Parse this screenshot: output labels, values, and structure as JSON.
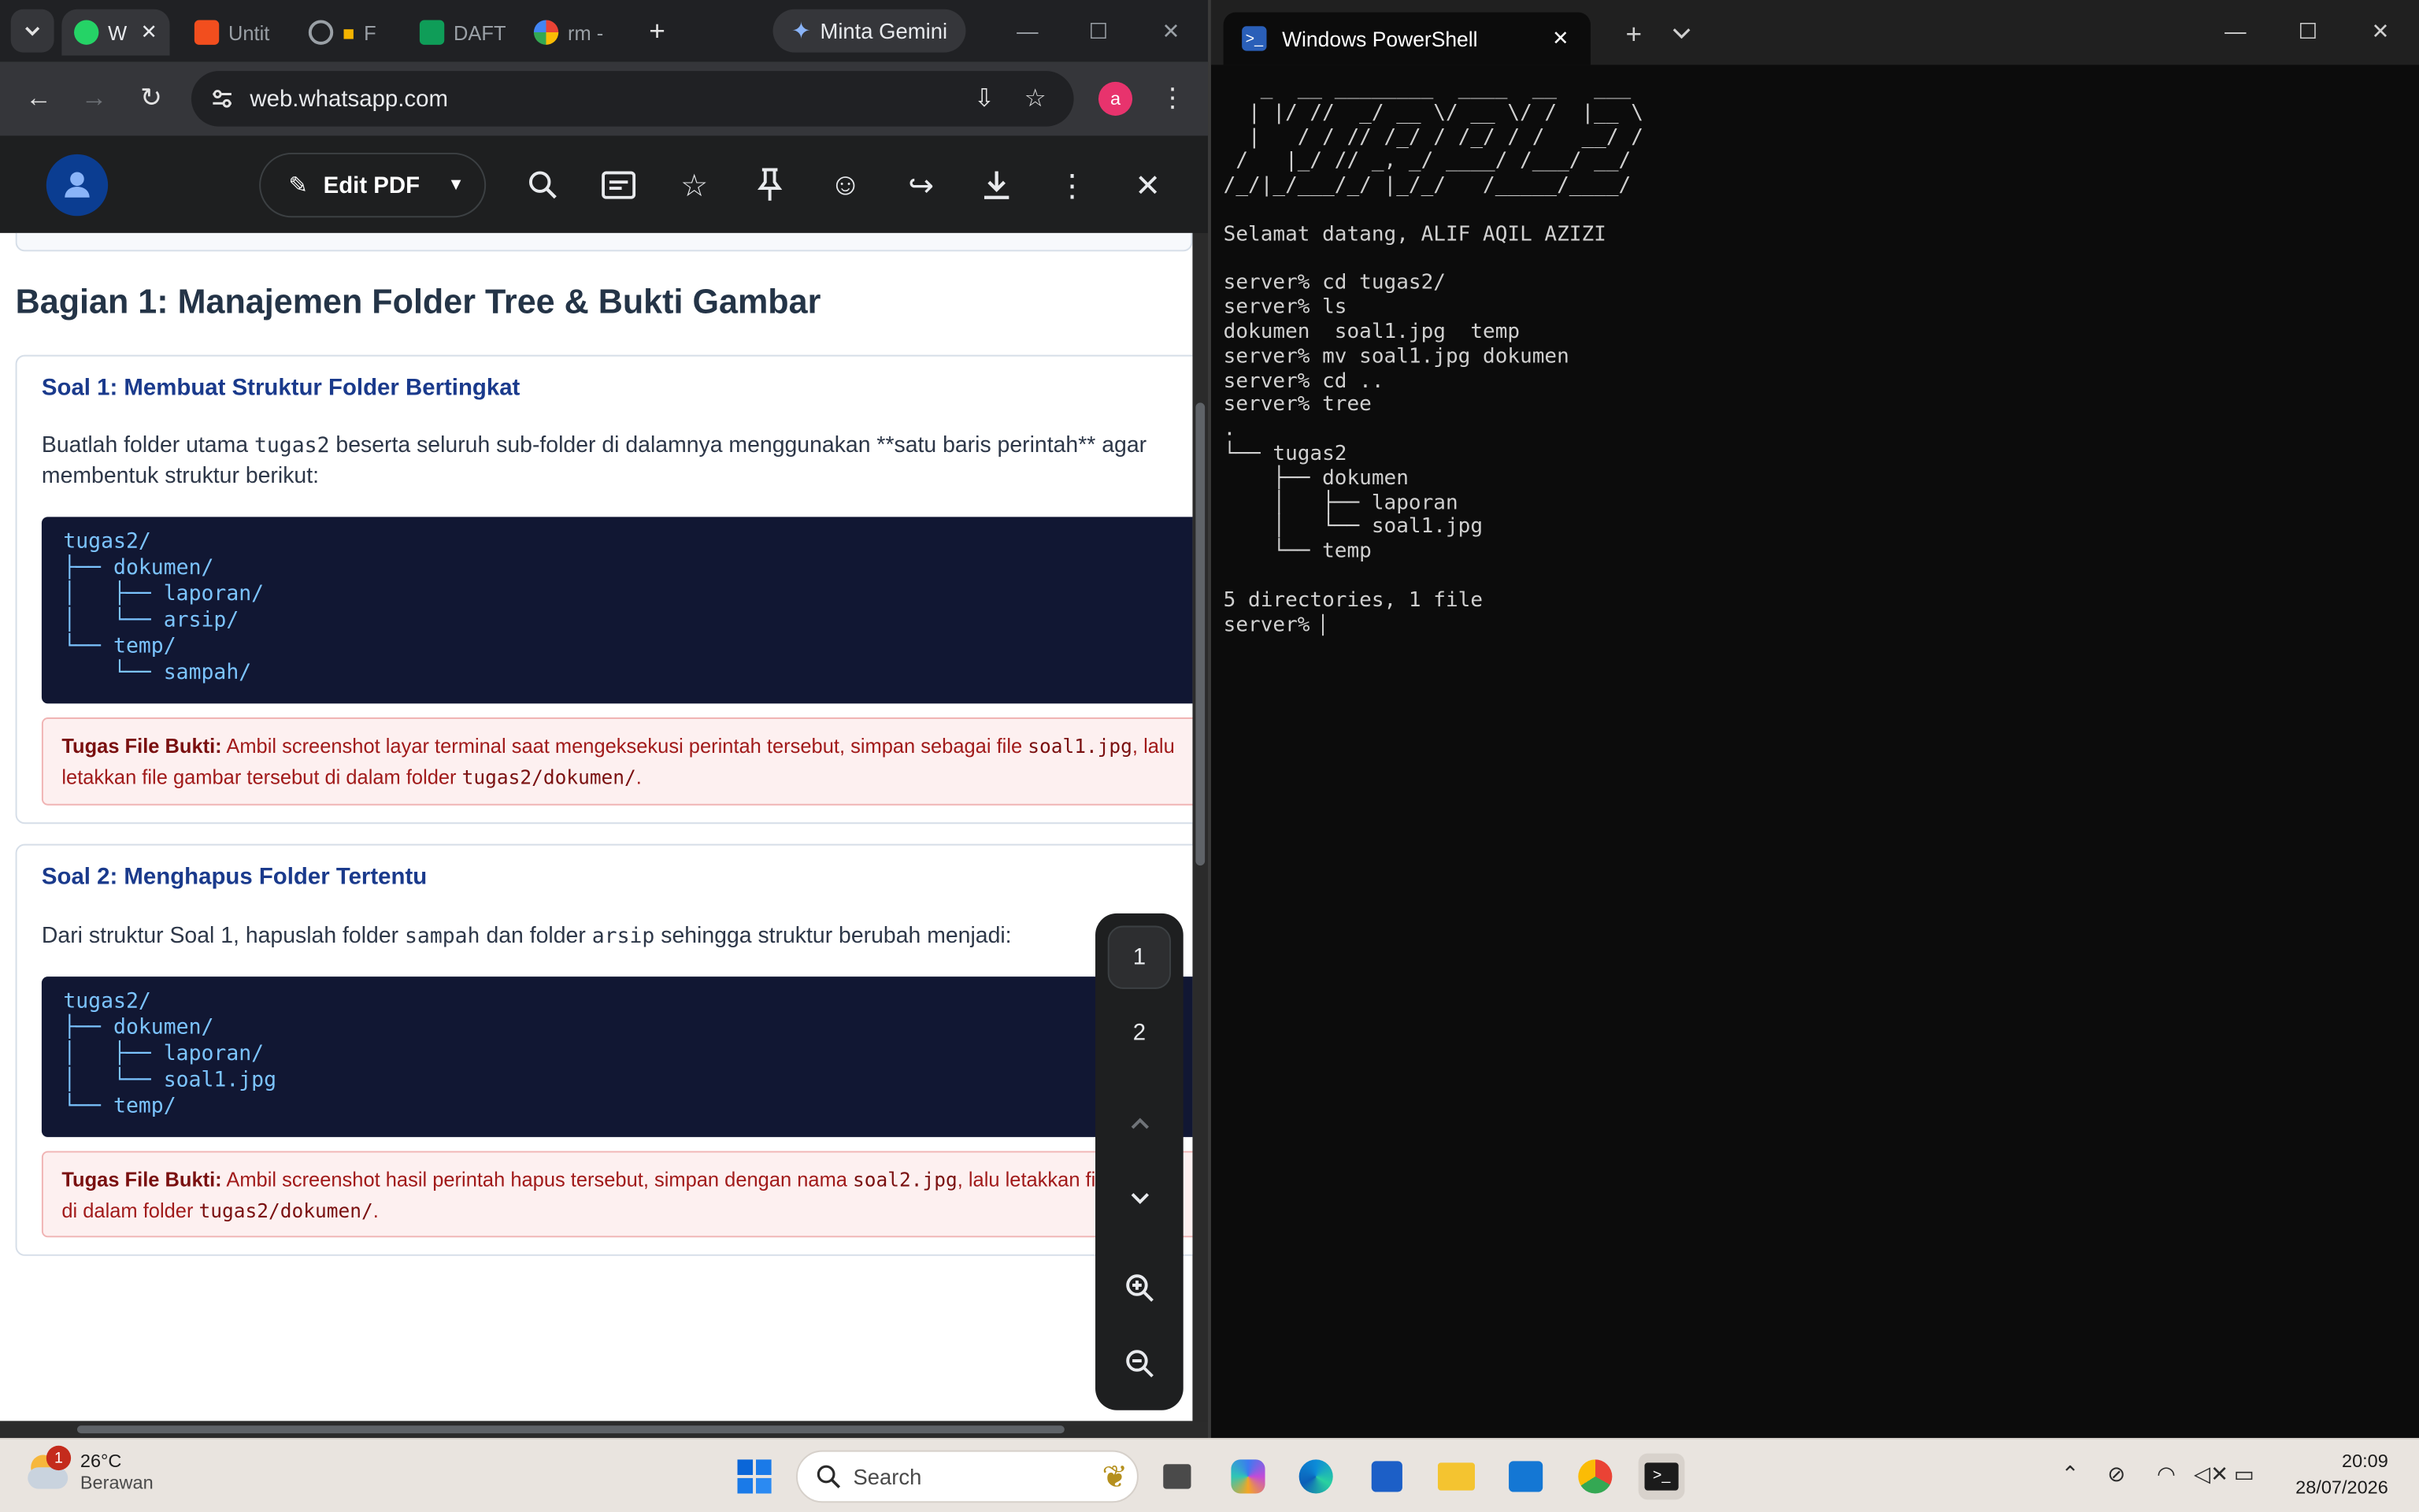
{
  "browser": {
    "tabs": [
      {
        "label": "W",
        "icon": "whatsapp-icon",
        "color": "#25d366"
      },
      {
        "label": "Untit",
        "icon": "figma-icon",
        "color": "#f24e1e"
      },
      {
        "label": "F",
        "icon": "globe-icon",
        "color": "#9aa0a6"
      },
      {
        "label": "DAFT",
        "icon": "sheets-icon",
        "color": "#0f9d58"
      },
      {
        "label": "rm -",
        "icon": "google-icon",
        "color": "#4285f4"
      }
    ],
    "gemini_label": "Minta Gemini",
    "url": "web.whatsapp.com",
    "profile_initial": "a"
  },
  "pdf": {
    "edit_label": "Edit PDF",
    "section_title": "Bagian 1: Manajemen Folder Tree & Bukti Gambar",
    "soal1": {
      "title": "Soal 1: Membuat Struktur Folder Bertingkat",
      "desc_a": "Buatlah folder utama ",
      "desc_code": "tugas2",
      "desc_b": " beserta seluruh sub-folder di dalamnya menggunakan **satu baris perintah** agar membentuk struktur berikut:",
      "code": "tugas2/\n├── dokumen/\n│   ├── laporan/\n│   └── arsip/\n└── temp/\n    └── sampah/",
      "task_label": "Tugas File Bukti:",
      "task_a": " Ambil screenshot layar terminal saat mengeksekusi perintah tersebut, simpan sebagai file ",
      "task_code1": "soal1.jpg",
      "task_b": ", lalu letakkan file gambar tersebut di dalam folder ",
      "task_code2": "tugas2/dokumen/",
      "task_c": "."
    },
    "soal2": {
      "title": "Soal 2: Menghapus Folder Tertentu",
      "desc_a": "Dari struktur Soal 1, hapuslah folder ",
      "desc_code1": "sampah",
      "desc_b": " dan folder ",
      "desc_code2": "arsip",
      "desc_c": " sehingga struktur berubah menjadi:",
      "code": "tugas2/\n├── dokumen/\n│   ├── laporan/\n│   └── soal1.jpg\n└── temp/",
      "task_label": "Tugas File Bukti:",
      "task_a": " Ambil screenshot hasil perintah hapus tersebut, simpan dengan nama ",
      "task_code1": "soal2.jpg",
      "task_b": ", lalu letakkan fil",
      "task_line2_a": "di dalam folder ",
      "task_code2": "tugas2/dokumen/",
      "task_c": "."
    },
    "pages": [
      "1",
      "2"
    ]
  },
  "terminal": {
    "tab_title": "Windows PowerShell",
    "output": "   _  __ ________  ____  __   ___\n  | |/ //  _/ __ \\/ __ \\/ /  |__ \\\n  |   / / // /_/ / /_/ / /   __/ /\n /   |_/ // _, _/ ____/ /___/ __/\n/_/|_/___/_/ |_/_/   /_____/____/\n\nSelamat datang, ALIF AQIL AZIZI\n\nserver% cd tugas2/\nserver% ls\ndokumen  soal1.jpg  temp\nserver% mv soal1.jpg dokumen\nserver% cd ..\nserver% tree\n.\n└── tugas2\n    ├── dokumen\n    │   ├── laporan\n    │   └── soal1.jpg\n    └── temp\n\n5 directories, 1 file\nserver% "
  },
  "taskbar": {
    "weather_temp": "26°C",
    "weather_desc": "Berawan",
    "weather_badge": "1",
    "search_placeholder": "Search",
    "time": "20:09",
    "date": "28/07/2026"
  }
}
